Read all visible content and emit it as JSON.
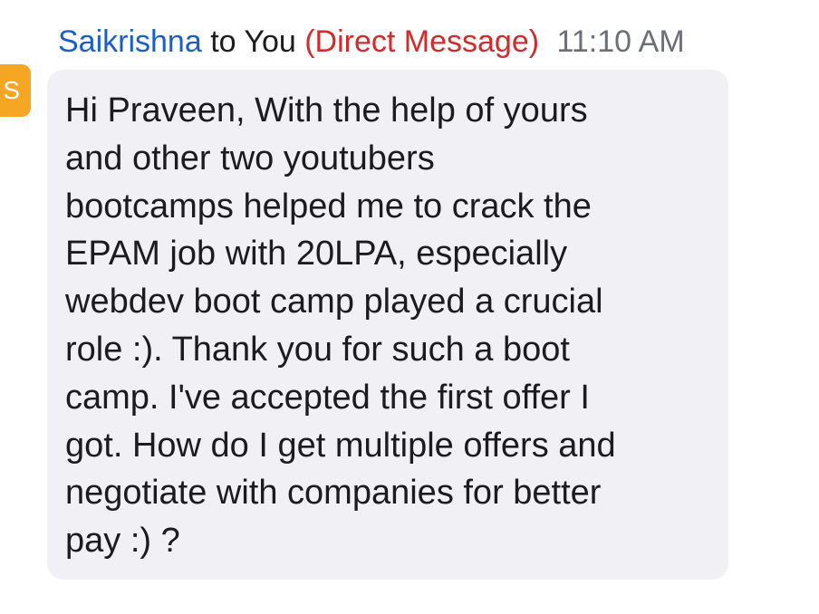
{
  "header": {
    "sender": "Saikrishna",
    "to_text": "to You",
    "dm_tag": "(Direct Message)",
    "time": "11:10 AM"
  },
  "avatar": {
    "initial": "S",
    "color": "#f5a623"
  },
  "message": {
    "text": "Hi Praveen, With the help of yours\nand other two youtubers\nbootcamps helped me to crack the\nEPAM job with 20LPA, especially\nwebdev boot camp played a crucial\nrole :). Thank you for such a boot\ncamp. I've accepted the first offer I\ngot. How do I get multiple offers and\nnegotiate with companies for better\npay :) ?"
  },
  "colors": {
    "sender": "#1a5fc9",
    "dm_tag": "#d42a2a",
    "time": "#6b6f76",
    "bubble_bg": "#f0f0f5"
  }
}
